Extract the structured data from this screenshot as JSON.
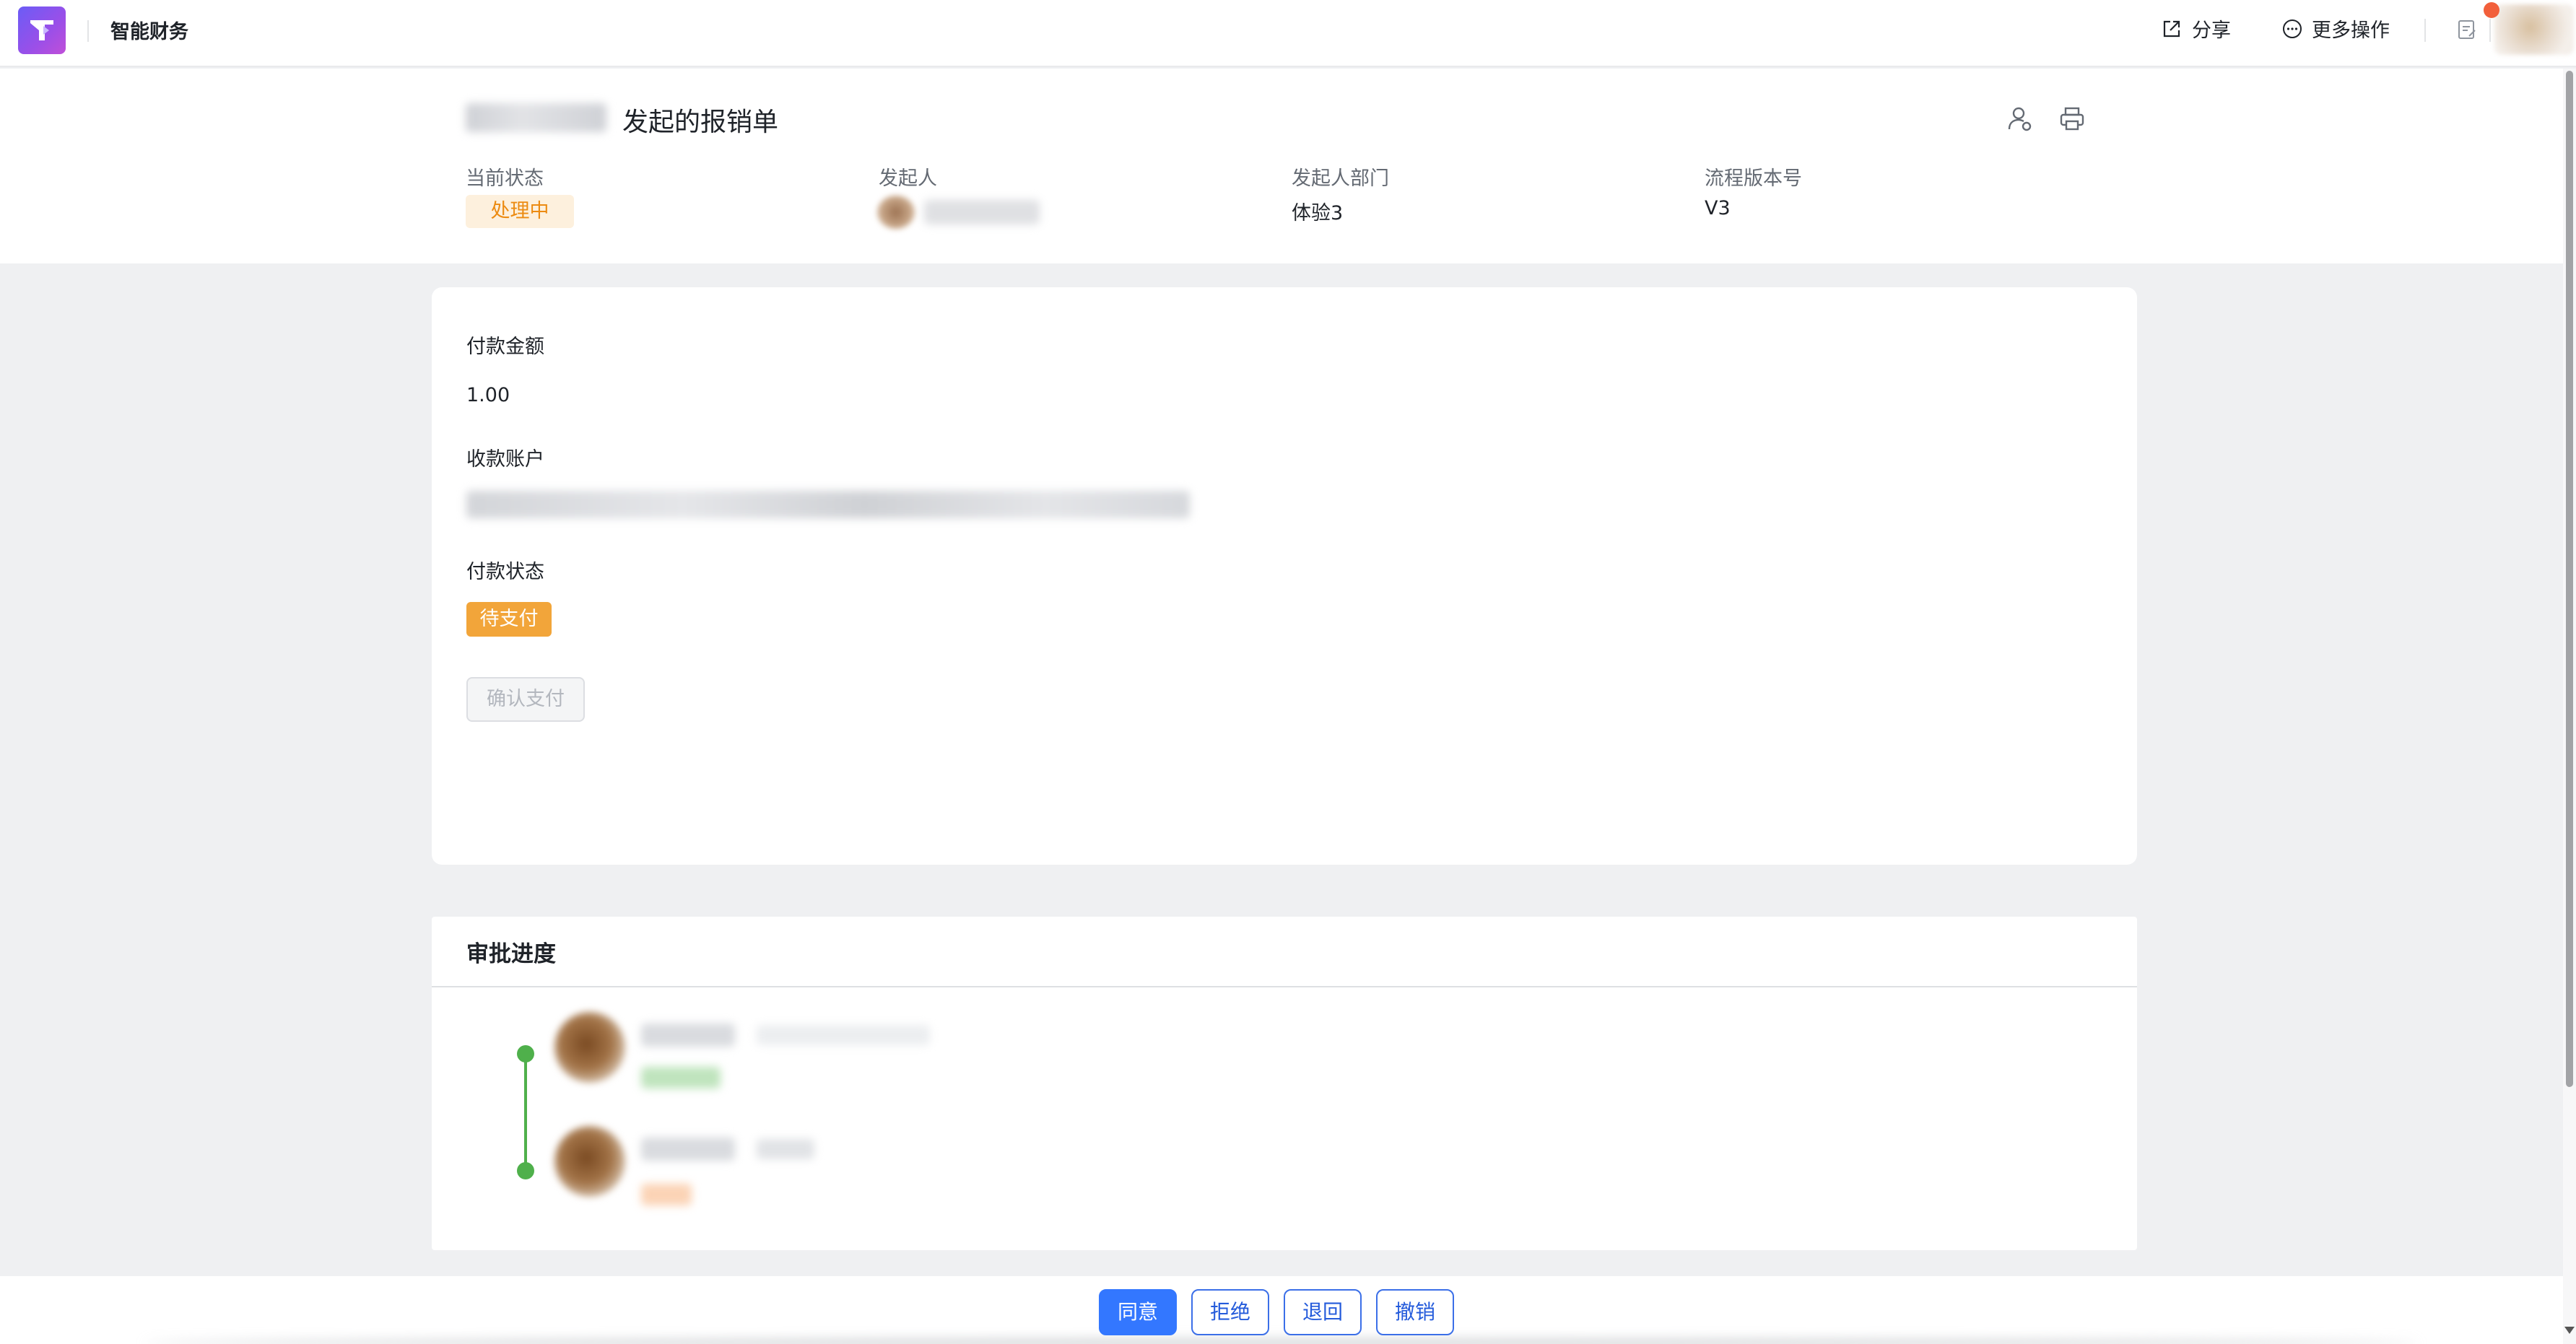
{
  "app": {
    "title": "智能财务"
  },
  "top_actions": {
    "share_label": "分享",
    "more_label": "更多操作"
  },
  "header": {
    "title": "发起的报销单",
    "meta": [
      {
        "label": "当前状态",
        "value": "处理中"
      },
      {
        "label": "发起人",
        "value": ""
      },
      {
        "label": "发起人部门",
        "value": "体验3"
      },
      {
        "label": "流程版本号",
        "value": "V3"
      }
    ]
  },
  "payment": {
    "amount_label": "付款金额",
    "amount_value": "1.00",
    "account_label": "收款账户",
    "status_label": "付款状态",
    "status_value": "待支付",
    "confirm_label": "确认支付"
  },
  "approval": {
    "title": "审批进度"
  },
  "actions": {
    "agree": "同意",
    "reject": "拒绝",
    "return": "退回",
    "revoke": "撤销"
  },
  "colors": {
    "accent": "#3377ff",
    "status_processing": "#ec8b12",
    "status_pending": "#f2a53a",
    "timeline": "#4fb04b",
    "logo_gradient_start": "#6b5cf6",
    "logo_gradient_end": "#c04fd8"
  }
}
